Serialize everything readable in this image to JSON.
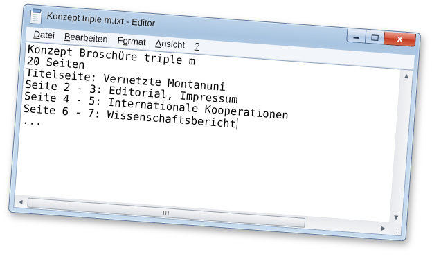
{
  "window": {
    "title": "Konzept triple m.txt - Editor",
    "controls": {
      "minimize": "",
      "maximize": "",
      "close": "x"
    }
  },
  "menu": {
    "items": [
      {
        "label": "Datei"
      },
      {
        "label": "Bearbeiten"
      },
      {
        "label": "Format"
      },
      {
        "label": "Ansicht"
      },
      {
        "label": "?"
      }
    ]
  },
  "document": {
    "lines": [
      "Konzept Broschüre triple m",
      "20 Seiten",
      "",
      "Titelseite: Vernetzte Montanuni",
      "Seite 2 - 3: Editorial, Impressum",
      "Seite 4 - 5: Internationale Kooperationen",
      "Seite 6 - 7: Wissenschaftsbericht",
      "..."
    ]
  },
  "scrollbar": {
    "thumb_grip": "III"
  },
  "colors": {
    "titlebar": "#a9c4e0",
    "close_button": "#c23a1f",
    "editor_background": "#ffffff"
  }
}
